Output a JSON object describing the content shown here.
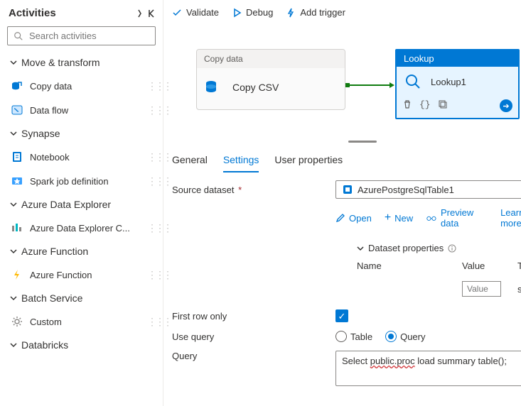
{
  "sidebar": {
    "title": "Activities",
    "search_placeholder": "Search activities",
    "sections": [
      {
        "label": "Move & transform",
        "items": [
          {
            "label": "Copy data",
            "icon": "copy-data"
          },
          {
            "label": "Data flow",
            "icon": "data-flow"
          }
        ]
      },
      {
        "label": "Synapse",
        "items": [
          {
            "label": "Notebook",
            "icon": "notebook"
          },
          {
            "label": "Spark job definition",
            "icon": "spark"
          }
        ]
      },
      {
        "label": "Azure Data Explorer",
        "items": [
          {
            "label": "Azure Data Explorer C...",
            "icon": "adx"
          }
        ]
      },
      {
        "label": "Azure Function",
        "items": [
          {
            "label": "Azure Function",
            "icon": "function"
          }
        ]
      },
      {
        "label": "Batch Service",
        "items": [
          {
            "label": "Custom",
            "icon": "custom"
          }
        ]
      },
      {
        "label": "Databricks",
        "items": []
      }
    ]
  },
  "toolbar": {
    "validate": "Validate",
    "debug": "Debug",
    "add_trigger": "Add trigger",
    "code": "{ }"
  },
  "canvas": {
    "copy_head": "Copy data",
    "copy_label": "Copy CSV",
    "lookup_head": "Lookup",
    "lookup_label": "Lookup1"
  },
  "tabs": {
    "general": "General",
    "settings": "Settings",
    "user_props": "User properties"
  },
  "form": {
    "source_dataset_label": "Source dataset",
    "source_dataset_value": "AzurePostgreSqlTable1",
    "links": {
      "open": "Open",
      "new": "New",
      "preview": "Preview data",
      "learn": "Learn more"
    },
    "dataset_props_label": "Dataset properties",
    "cols": {
      "name": "Name",
      "value": "Value",
      "type": "Type"
    },
    "value_placeholder": "Value",
    "type_value": "string",
    "first_row_label": "First row only",
    "first_row_checked": true,
    "use_query_label": "Use query",
    "use_query_options": {
      "table": "Table",
      "query": "Query"
    },
    "use_query_selected": "query",
    "query_label": "Query",
    "query_value_pre": "Select ",
    "query_value_u": "public.proc",
    "query_value_post": " load summary table();"
  }
}
